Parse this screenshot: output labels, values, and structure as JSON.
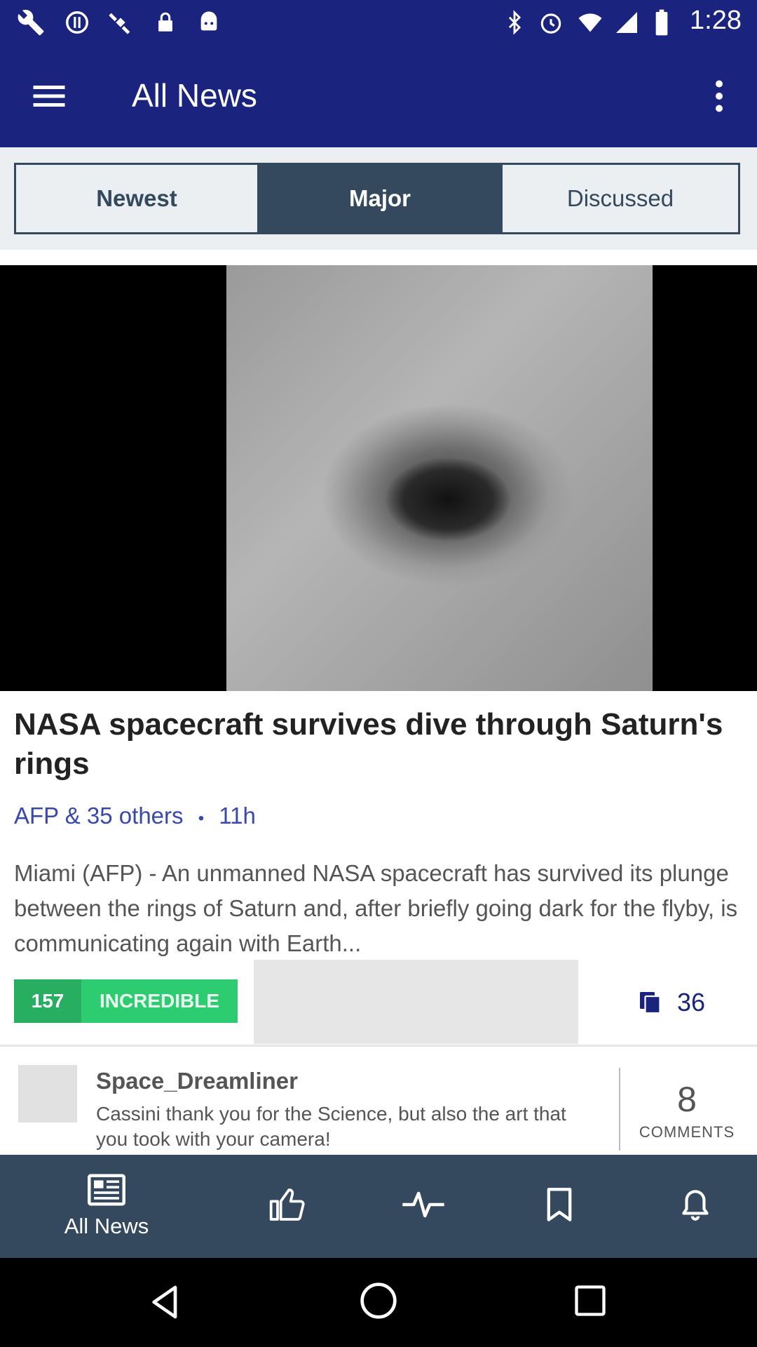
{
  "status_bar": {
    "time": "1:28"
  },
  "app_bar": {
    "title": "All News"
  },
  "tabs": {
    "newest": "Newest",
    "major": "Major",
    "discussed": "Discussed",
    "active": "Major"
  },
  "article": {
    "headline": "NASA spacecraft survives dive through Saturn's rings",
    "source": "AFP & 35 others",
    "separator": "•",
    "age": "11h",
    "snippet": "Miami (AFP) - An unmanned NASA spacecraft has survived its plunge between the rings of Saturn and, after briefly going dark for the flyby, is communicating again with Earth...",
    "reaction_count": "157",
    "reaction_label": "INCREDIBLE",
    "share_count": "36"
  },
  "comment": {
    "user": "Space_Dreamliner",
    "text": "Cassini thank you for the Science, but also the art that you took with your camera!",
    "count": "8",
    "count_label": "COMMENTS"
  },
  "bottom_nav": {
    "items": [
      {
        "label": "All News",
        "icon": "newspaper-icon"
      },
      {
        "label": "",
        "icon": "thumbs-up-icon"
      },
      {
        "label": "",
        "icon": "pulse-icon"
      },
      {
        "label": "",
        "icon": "bookmark-icon"
      },
      {
        "label": "",
        "icon": "bell-icon"
      }
    ]
  },
  "colors": {
    "primary": "#1a237e",
    "tab_active": "#34495e",
    "reaction_green": "#27ae60",
    "link_blue": "#3949ab"
  }
}
